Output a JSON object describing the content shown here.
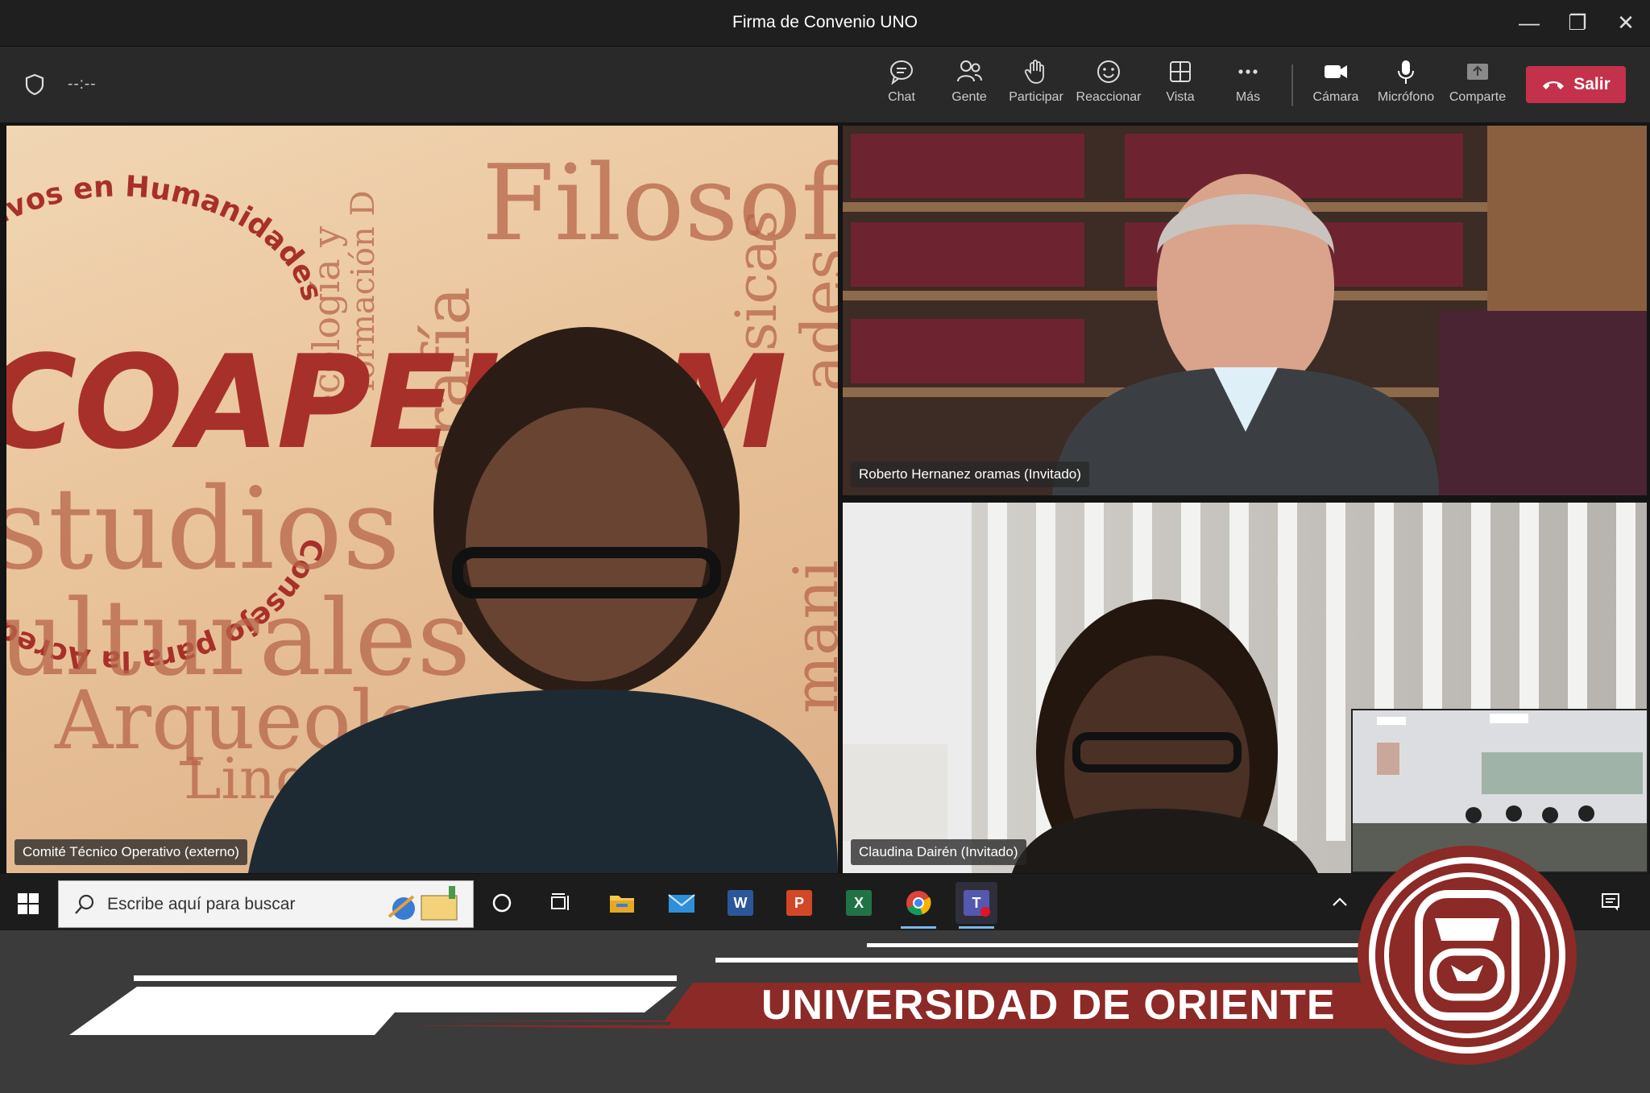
{
  "window": {
    "title": "Firma de Convenio UNO"
  },
  "meeting": {
    "timer": "--:--",
    "toolbar": [
      {
        "label": "Chat",
        "icon": "chat-icon"
      },
      {
        "label": "Gente",
        "icon": "people-icon"
      },
      {
        "label": "Participar",
        "icon": "raise-hand-icon"
      },
      {
        "label": "Reaccionar",
        "icon": "smiley-icon"
      },
      {
        "label": "Vista",
        "icon": "grid-view-icon"
      },
      {
        "label": "Más",
        "icon": "more-icon"
      },
      {
        "label": "Cámara",
        "icon": "camera-icon"
      },
      {
        "label": "Micrófono",
        "icon": "microphone-icon"
      },
      {
        "label": "Comparte",
        "icon": "share-icon"
      }
    ],
    "leave_label": "Salir",
    "colors": {
      "leave": "#c4314b",
      "bar": "#292929"
    }
  },
  "participants": {
    "main": "Comité Técnico Operativo (externo)",
    "top_right": "Roberto Hernanez oramas (Invitado)",
    "bottom_right": "Claudina Dairén (Invitado)"
  },
  "background_words": {
    "coapehum": "COAPEHUM",
    "filosofia": "Filosofí",
    "estudios": "studios",
    "culturales": "ulturales",
    "arqueologia": "Arqueolo",
    "linguistica": "Ling",
    "arc_top": "tivos en Humanidades",
    "arc_bottom": "Consejo para la Acred",
    "vertical_1": "ecología y",
    "vertical_2": "formación D",
    "vertical_3": "grafía",
    "vertical_4": "sicas",
    "vertical_5": "ades",
    "vertical_6": "mani"
  },
  "taskbar": {
    "search_placeholder": "Escribe aquí para buscar",
    "apps": [
      "Cortana",
      "Vista de tareas",
      "Explorador de archivos",
      "Correo",
      "Word",
      "PowerPoint",
      "Excel",
      "Chrome",
      "Teams"
    ]
  },
  "banner": {
    "title": "UNIVERSIDAD DE ORIENTE"
  }
}
